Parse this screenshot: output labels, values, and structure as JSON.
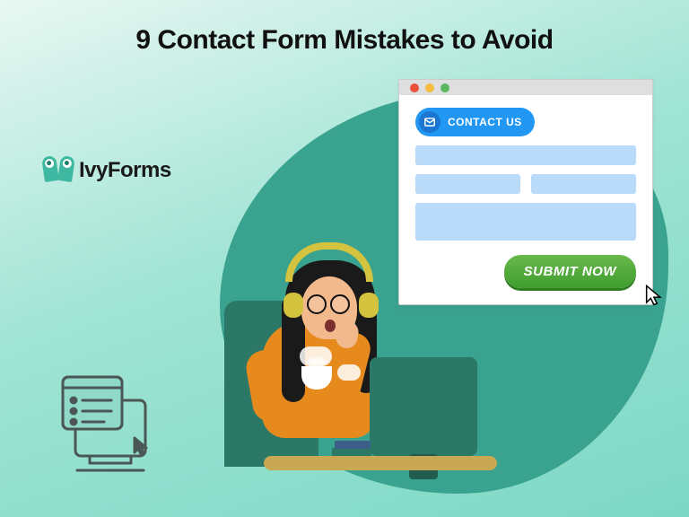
{
  "title": "9 Contact Form Mistakes to Avoid",
  "logo": {
    "text": "IvyForms"
  },
  "form": {
    "contact_label": "CONTACT US",
    "submit_label": "SUBMIT NOW"
  }
}
